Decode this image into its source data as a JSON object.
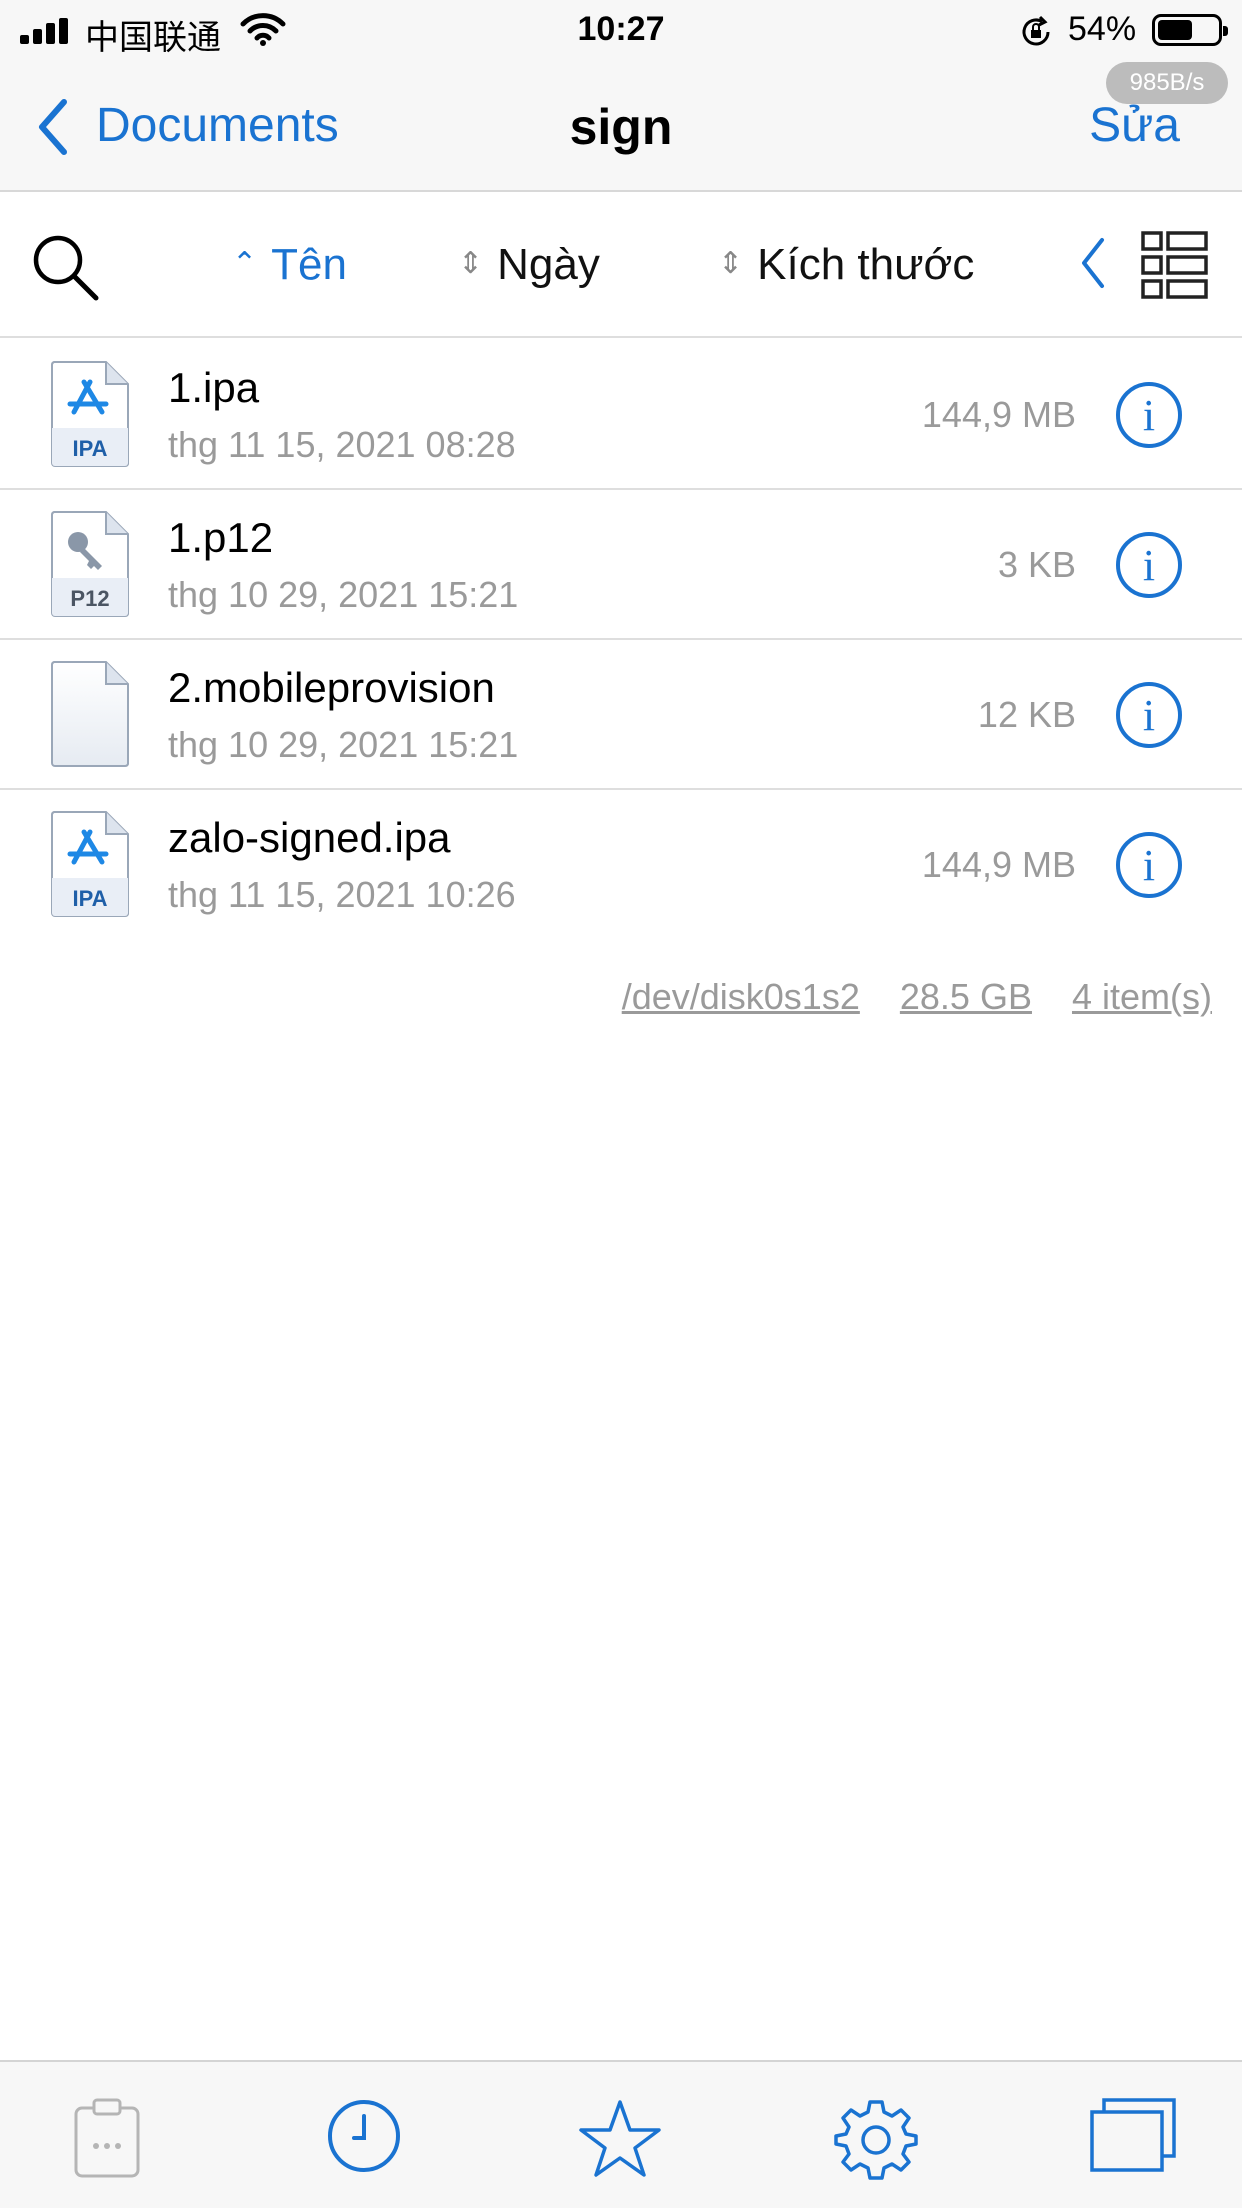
{
  "status_bar": {
    "carrier": "中国联通",
    "time": "10:27",
    "battery_percent": "54%",
    "net_speed": "985B/s"
  },
  "nav": {
    "back_label": "Documents",
    "title": "sign",
    "edit_label": "Sửa"
  },
  "sort_bar": {
    "name": "Tên",
    "date": "Ngày",
    "size": "Kích thước"
  },
  "files": [
    {
      "name": "1.ipa",
      "date": "thg 11 15, 2021 08:28",
      "size": "144,9 MB",
      "icon": "ipa-file-icon",
      "badge": "IPA"
    },
    {
      "name": "1.p12",
      "date": "thg 10 29, 2021 15:21",
      "size": "3 KB",
      "icon": "p12-file-icon",
      "badge": "P12"
    },
    {
      "name": "2.mobileprovision",
      "date": "thg 10 29, 2021 15:21",
      "size": "12 KB",
      "icon": "blank-file-icon",
      "badge": ""
    },
    {
      "name": "zalo-signed.ipa",
      "date": "thg 11 15, 2021 10:26",
      "size": "144,9 MB",
      "icon": "ipa-file-icon",
      "badge": "IPA"
    }
  ],
  "footer": {
    "disk": "/dev/disk0s1s2",
    "free": "28.5 GB",
    "count": "4 item(s)"
  },
  "colors": {
    "accent": "#1a73d1",
    "secondary_text": "#9a9a9a"
  }
}
